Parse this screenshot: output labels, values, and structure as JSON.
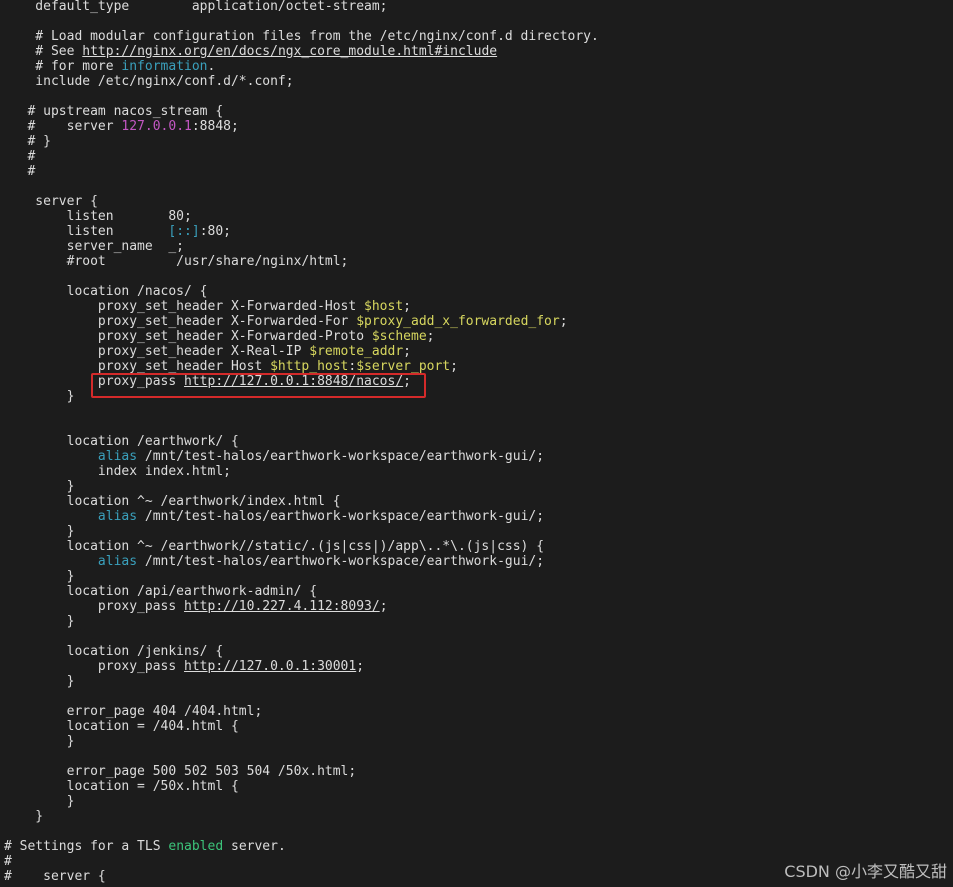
{
  "terminal": {
    "lines": [
      [
        {
          "t": "    default_type        application/octet-stream;",
          "c": ""
        }
      ],
      [],
      [
        {
          "t": "    # Load modular configuration files from the /etc/nginx/conf.d directory.",
          "c": ""
        }
      ],
      [
        {
          "t": "    # See ",
          "c": ""
        },
        {
          "t": "http://nginx.org/en/docs/ngx_core_module.html#include",
          "c": "u"
        }
      ],
      [
        {
          "t": "    # for more ",
          "c": ""
        },
        {
          "t": "information",
          "c": "c"
        },
        {
          "t": ".",
          "c": ""
        }
      ],
      [
        {
          "t": "    include /etc/nginx/conf.d/*.conf;",
          "c": ""
        }
      ],
      [],
      [
        {
          "t": "   # upstream nacos_stream {",
          "c": ""
        }
      ],
      [
        {
          "t": "   #    server ",
          "c": ""
        },
        {
          "t": "127.0.0.1",
          "c": "m"
        },
        {
          "t": ":8848;",
          "c": ""
        }
      ],
      [
        {
          "t": "   # }",
          "c": ""
        }
      ],
      [
        {
          "t": "   #",
          "c": ""
        }
      ],
      [
        {
          "t": "   #",
          "c": ""
        }
      ],
      [],
      [
        {
          "t": "    server {",
          "c": ""
        }
      ],
      [
        {
          "t": "        listen       80;",
          "c": ""
        }
      ],
      [
        {
          "t": "        listen       ",
          "c": ""
        },
        {
          "t": "[::]",
          "c": "c"
        },
        {
          "t": ":80;",
          "c": ""
        }
      ],
      [
        {
          "t": "        server_name  _;",
          "c": ""
        }
      ],
      [
        {
          "t": "        #root         /usr/share/nginx/html;",
          "c": ""
        }
      ],
      [],
      [
        {
          "t": "        location /nacos/ {",
          "c": ""
        }
      ],
      [
        {
          "t": "            proxy_set_header X-Forwarded-Host ",
          "c": ""
        },
        {
          "t": "$host",
          "c": "y"
        },
        {
          "t": ";",
          "c": ""
        }
      ],
      [
        {
          "t": "            proxy_set_header X-Forwarded-For ",
          "c": ""
        },
        {
          "t": "$proxy_add_x_forwarded_for",
          "c": "y"
        },
        {
          "t": ";",
          "c": ""
        }
      ],
      [
        {
          "t": "            proxy_set_header X-Forwarded-Proto ",
          "c": ""
        },
        {
          "t": "$scheme",
          "c": "y"
        },
        {
          "t": ";",
          "c": ""
        }
      ],
      [
        {
          "t": "            proxy_set_header X-Real-IP ",
          "c": ""
        },
        {
          "t": "$remote_addr",
          "c": "y"
        },
        {
          "t": ";",
          "c": ""
        }
      ],
      [
        {
          "t": "            proxy_set_header Host ",
          "c": ""
        },
        {
          "t": "$http_host",
          "c": "y"
        },
        {
          "t": ":",
          "c": ""
        },
        {
          "t": "$server_port",
          "c": "y"
        },
        {
          "t": ";",
          "c": ""
        }
      ],
      [
        {
          "t": "            proxy_pass ",
          "c": ""
        },
        {
          "t": "http://127.0.0.1:8848/nacos/",
          "c": "u"
        },
        {
          "t": ";",
          "c": ""
        }
      ],
      [
        {
          "t": "        }",
          "c": ""
        }
      ],
      [],
      [],
      [
        {
          "t": "        location /earthwork/ {",
          "c": ""
        }
      ],
      [
        {
          "t": "            ",
          "c": ""
        },
        {
          "t": "alias",
          "c": "c"
        },
        {
          "t": " /mnt/test-halos/earthwork-workspace/earthwork-gui/;",
          "c": ""
        }
      ],
      [
        {
          "t": "            index index.html;",
          "c": ""
        }
      ],
      [
        {
          "t": "        }",
          "c": ""
        }
      ],
      [
        {
          "t": "        location ^~ /earthwork/index.html {",
          "c": ""
        }
      ],
      [
        {
          "t": "            ",
          "c": ""
        },
        {
          "t": "alias",
          "c": "c"
        },
        {
          "t": " /mnt/test-halos/earthwork-workspace/earthwork-gui/;",
          "c": ""
        }
      ],
      [
        {
          "t": "        }",
          "c": ""
        }
      ],
      [
        {
          "t": "        location ^~ /earthwork//static/.(js|css|)/app\\..*\\.(js|css) {",
          "c": ""
        }
      ],
      [
        {
          "t": "            ",
          "c": ""
        },
        {
          "t": "alias",
          "c": "c"
        },
        {
          "t": " /mnt/test-halos/earthwork-workspace/earthwork-gui/;",
          "c": ""
        }
      ],
      [
        {
          "t": "        }",
          "c": ""
        }
      ],
      [
        {
          "t": "        location /api/earthwork-admin/ {",
          "c": ""
        }
      ],
      [
        {
          "t": "            proxy_pass ",
          "c": ""
        },
        {
          "t": "http://10.227.4.112:8093/",
          "c": "u"
        },
        {
          "t": ";",
          "c": ""
        }
      ],
      [
        {
          "t": "        }",
          "c": ""
        }
      ],
      [],
      [
        {
          "t": "        location /jenkins/ {",
          "c": ""
        }
      ],
      [
        {
          "t": "            proxy_pass ",
          "c": ""
        },
        {
          "t": "http://127.0.0.1:30001",
          "c": "u"
        },
        {
          "t": ";",
          "c": ""
        }
      ],
      [
        {
          "t": "        }",
          "c": ""
        }
      ],
      [],
      [
        {
          "t": "        error_page 404 /404.html;",
          "c": ""
        }
      ],
      [
        {
          "t": "        location = /404.html {",
          "c": ""
        }
      ],
      [
        {
          "t": "        }",
          "c": ""
        }
      ],
      [],
      [
        {
          "t": "        error_page 500 502 503 504 /50x.html;",
          "c": ""
        }
      ],
      [
        {
          "t": "        location = /50x.html {",
          "c": ""
        }
      ],
      [
        {
          "t": "        }",
          "c": ""
        }
      ],
      [
        {
          "t": "    }",
          "c": ""
        }
      ],
      [],
      [
        {
          "t": "# Settings for a TLS ",
          "c": ""
        },
        {
          "t": "enabled",
          "c": "g"
        },
        {
          "t": " server.",
          "c": ""
        }
      ],
      [
        {
          "t": "#",
          "c": ""
        }
      ],
      [
        {
          "t": "#    server {",
          "c": ""
        }
      ]
    ]
  },
  "watermark": "CSDN @小李又酷又甜",
  "colors": {
    "background": "#1c1c1c",
    "text": "#dcdcdc",
    "variable": "#d7d75f",
    "keyword": "#3aa0bc",
    "number": "#c357c3",
    "green": "#3cc47a",
    "highlight": "#d42a2a"
  }
}
